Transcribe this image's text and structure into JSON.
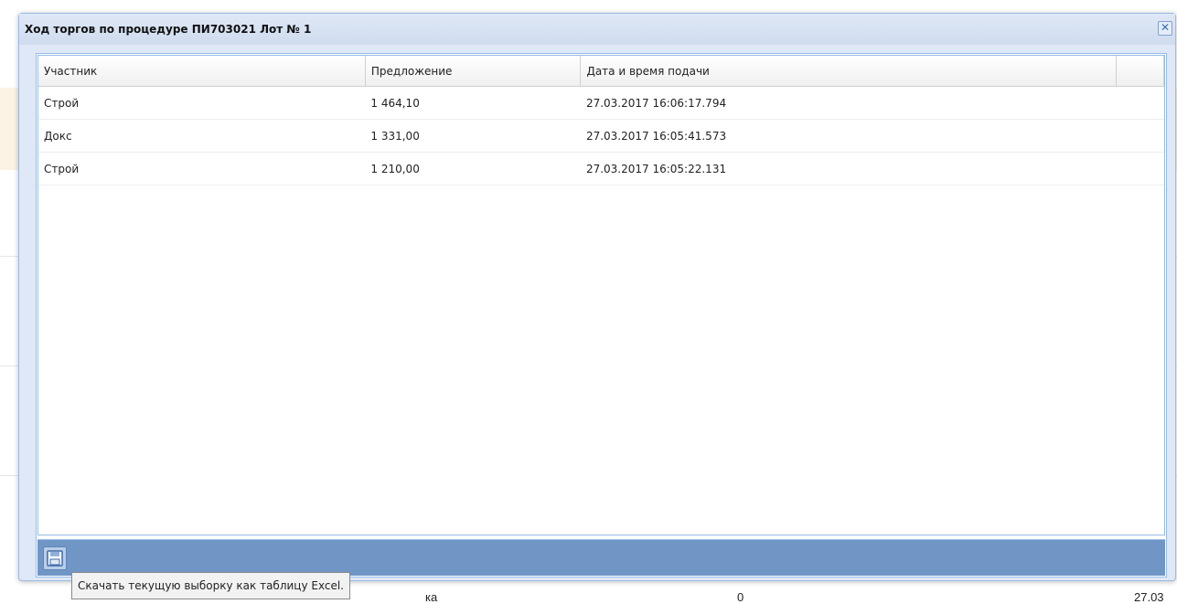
{
  "window": {
    "title": "Ход торгов по процедуре ПИ703021 Лот № 1",
    "close_symbol": "✕"
  },
  "grid": {
    "columns": [
      "Участник",
      "Предложение",
      "Дата и время подачи"
    ],
    "rows": [
      [
        "Строй",
        "1 464,10",
        "27.03.2017 16:06:17.794"
      ],
      [
        "Докс",
        "1 331,00",
        "27.03.2017 16:05:41.573"
      ],
      [
        "Строй",
        "1 210,00",
        "27.03.2017 16:05:22.131"
      ]
    ]
  },
  "toolbar": {
    "export_icon": "floppy-disk-icon",
    "tooltip": "Скачать текущую выборку как таблицу Excel."
  },
  "background": {
    "partial_text_1": "ка",
    "partial_text_2": "0",
    "partial_text_3": "27.03"
  },
  "colors": {
    "toolbar": "#7096c6",
    "border": "#99bbe8",
    "window_bg": "#dfe8f6"
  }
}
